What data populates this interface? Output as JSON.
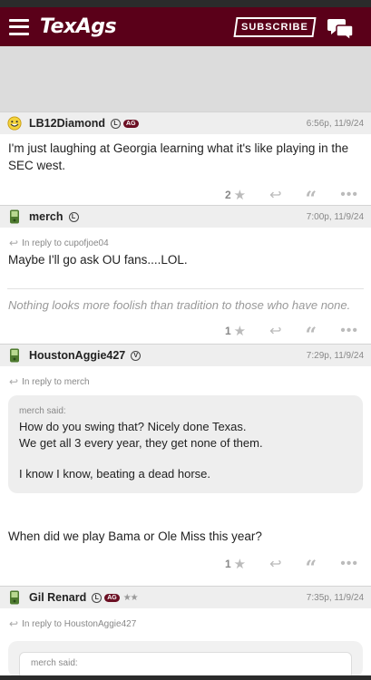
{
  "header": {
    "logo": "TexAgs",
    "subscribe_label": "SUBSCRIBE"
  },
  "posts": [
    {
      "username": "LB12Diamond",
      "badge_l": "L",
      "badge_ag": "AG",
      "timestamp": "6:56p, 11/9/24",
      "body": "I'm just laughing at Georgia learning what it's like playing in the SEC west.",
      "likes": "2"
    },
    {
      "username": "merch",
      "badge_l": "L",
      "timestamp": "7:00p, 11/9/24",
      "reply_to": "In reply to cupofjoe04",
      "body": "Maybe I'll go ask OU fans....LOL.",
      "signature": "Nothing looks more foolish than tradition to those who have none.",
      "likes": "1"
    },
    {
      "username": "HoustonAggie427",
      "badge_v": "V",
      "timestamp": "7:29p, 11/9/24",
      "reply_to": "In reply to merch",
      "quote_author": "merch said:",
      "quote_lines": [
        "How do you swing that? Nicely done Texas.",
        "We get all 3 every year, they get none of them.",
        "I know I know, beating a dead horse."
      ],
      "body": "When did we play Bama or Ole Miss this year?",
      "likes": "1"
    },
    {
      "username": "Gil Renard",
      "badge_l": "L",
      "badge_ag": "AG",
      "stars": "★★",
      "timestamp": "7:35p, 11/9/24",
      "reply_to": "In reply to HoustonAggie427",
      "quote_author": "merch said:"
    }
  ],
  "colors": {
    "brand": "#5a0019",
    "post_header_bg": "#eeeeee",
    "ad_bg": "#dcdcdc"
  },
  "icons": {
    "menu": "hamburger-icon",
    "chat": "chat-bubbles-icon",
    "star": "star-icon",
    "reply": "reply-arrow-icon",
    "quote": "quote-icon",
    "more": "more-dots-icon"
  }
}
